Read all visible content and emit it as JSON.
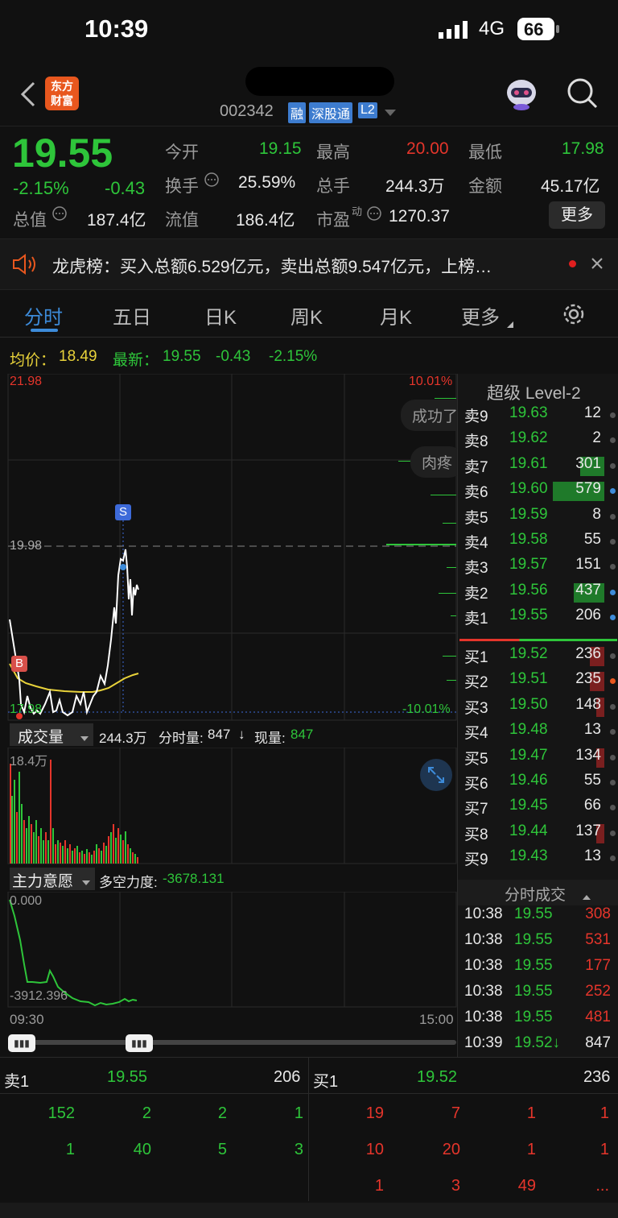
{
  "status_bar": {
    "time": "10:39",
    "network": "4G",
    "battery": "66"
  },
  "nav": {
    "logo_line1": "东方",
    "logo_line2": "财富",
    "code": "002342",
    "tags": [
      "融",
      "深股通",
      "L2"
    ]
  },
  "quote": {
    "price": "19.55",
    "change_pct": "-2.15%",
    "change": "-0.43",
    "open_label": "今开",
    "open": "19.15",
    "high_label": "最高",
    "high": "20.00",
    "low_label": "最低",
    "low": "17.98",
    "turnover_label": "换手",
    "turnover": "25.59%",
    "volume_label": "总手",
    "volume": "244.3万",
    "amount_label": "金额",
    "amount": "45.17亿",
    "mktcap_label": "总值",
    "mktcap": "187.4亿",
    "float_label": "流值",
    "float": "186.4亿",
    "pe_label": "市盈",
    "pe_sup": "动",
    "pe": "1270.37",
    "more_label": "更多"
  },
  "news": {
    "text": "龙虎榜：买入总额6.529亿元，卖出总额9.547亿元，上榜…"
  },
  "tabs": [
    "分时",
    "五日",
    "日K",
    "周K",
    "月K",
    "更多"
  ],
  "chart": {
    "avg_label": "均价：",
    "avg": "18.49",
    "latest_label": "最新：",
    "latest": "19.55",
    "latest_chg": "-0.43",
    "latest_pct": "-2.15%",
    "y_top": "21.98",
    "y_mid": "19.98",
    "y_bottom": "17.98",
    "pct_top": "10.01%",
    "pct_bottom": "-10.01%",
    "bubble1": "成功了",
    "bubble2": "肉疼",
    "marker_s": "S",
    "marker_b": "B",
    "vol_label": "成交量",
    "vol_total": "244.3万",
    "vol_period_label": "分时量:",
    "vol_period": "847",
    "vol_arrow": "↓",
    "vol_now_label": "现量:",
    "vol_now": "847",
    "vol_max": "18.4万",
    "ind_label": "主力意愿",
    "ind_text": "多空力度:",
    "ind_value": "-3678.131",
    "ind_top": "0.000",
    "ind_bottom": "-3912.396",
    "time_start": "09:30",
    "time_end": "15:00"
  },
  "level2": {
    "title": "超级 Level-2",
    "asks": [
      {
        "label": "卖9",
        "price": "19.63",
        "vol": "12"
      },
      {
        "label": "卖8",
        "price": "19.62",
        "vol": "2"
      },
      {
        "label": "卖7",
        "price": "19.61",
        "vol": "301"
      },
      {
        "label": "卖6",
        "price": "19.60",
        "vol": "579"
      },
      {
        "label": "卖5",
        "price": "19.59",
        "vol": "8"
      },
      {
        "label": "卖4",
        "price": "19.58",
        "vol": "55"
      },
      {
        "label": "卖3",
        "price": "19.57",
        "vol": "151"
      },
      {
        "label": "卖2",
        "price": "19.56",
        "vol": "437"
      },
      {
        "label": "卖1",
        "price": "19.55",
        "vol": "206"
      }
    ],
    "bids": [
      {
        "label": "买1",
        "price": "19.52",
        "vol": "236"
      },
      {
        "label": "买2",
        "price": "19.51",
        "vol": "235"
      },
      {
        "label": "买3",
        "price": "19.50",
        "vol": "148"
      },
      {
        "label": "买4",
        "price": "19.48",
        "vol": "13"
      },
      {
        "label": "买5",
        "price": "19.47",
        "vol": "134"
      },
      {
        "label": "买6",
        "price": "19.46",
        "vol": "55"
      },
      {
        "label": "买7",
        "price": "19.45",
        "vol": "66"
      },
      {
        "label": "买8",
        "price": "19.44",
        "vol": "137"
      },
      {
        "label": "买9",
        "price": "19.43",
        "vol": "13"
      }
    ],
    "trades_title": "分时成交",
    "trades": [
      {
        "time": "10:38",
        "price": "19.55",
        "vol": "308"
      },
      {
        "time": "10:38",
        "price": "19.55",
        "vol": "531"
      },
      {
        "time": "10:38",
        "price": "19.55",
        "vol": "177"
      },
      {
        "time": "10:38",
        "price": "19.55",
        "vol": "252"
      },
      {
        "time": "10:38",
        "price": "19.55",
        "vol": "481"
      },
      {
        "time": "10:39",
        "price": "19.52↓",
        "vol": "847"
      }
    ]
  },
  "queue": {
    "ask_label": "卖1",
    "ask_price": "19.55",
    "ask_vol": "206",
    "bid_label": "买1",
    "bid_price": "19.52",
    "bid_vol": "236",
    "ask_rows": [
      [
        "152",
        "2",
        "2",
        "1"
      ],
      [
        "1",
        "40",
        "5",
        "3"
      ]
    ],
    "bid_rows": [
      [
        "19",
        "7",
        "1",
        "1"
      ],
      [
        "10",
        "20",
        "1",
        "1"
      ],
      [
        "1",
        "3",
        "49",
        "..."
      ]
    ]
  },
  "colors": {
    "up": "#e5352b",
    "down": "#2ec53a",
    "avg_line": "#e8d23a",
    "accent": "#3d8bd9"
  }
}
